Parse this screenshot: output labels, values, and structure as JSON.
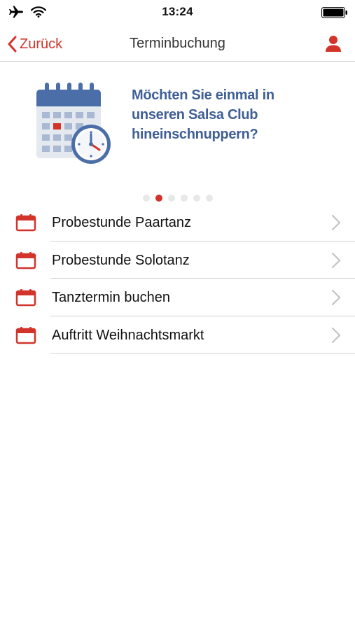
{
  "status": {
    "time": "13:24"
  },
  "nav": {
    "back_label": "Zurück",
    "title": "Terminbuchung"
  },
  "banner": {
    "lines": [
      "Möchten Sie einmal in",
      "unseren Salsa Club",
      "hineinschnuppern?"
    ]
  },
  "pager": {
    "count": 6,
    "active": 1
  },
  "menu": {
    "items": [
      {
        "label": "Probestunde Paartanz"
      },
      {
        "label": "Probestunde Solotanz"
      },
      {
        "label": "Tanztermin buchen"
      },
      {
        "label": "Auftritt Weihnachtsmarkt"
      }
    ]
  },
  "colors": {
    "accent": "#d2332b",
    "banner_text": "#3f5f95",
    "divider": "#d0d0d0"
  }
}
